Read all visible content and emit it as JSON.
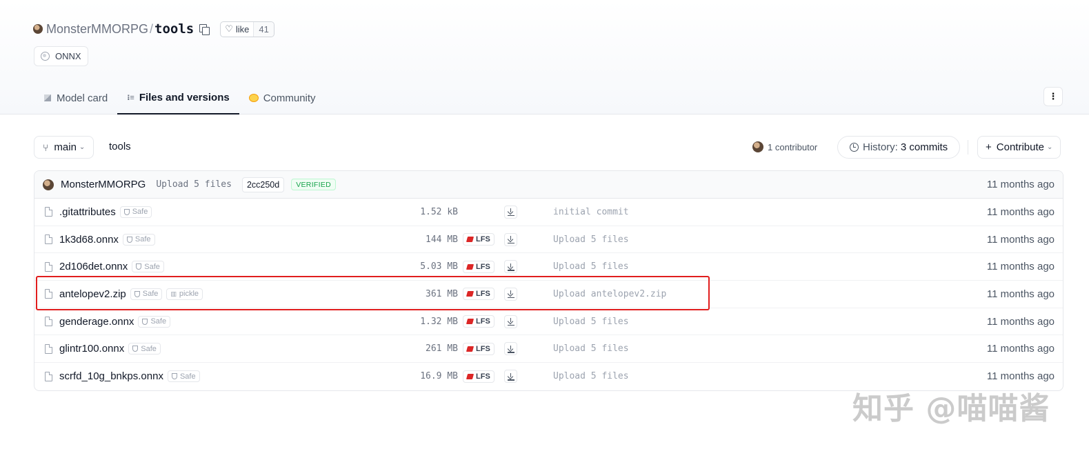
{
  "repo": {
    "owner": "MonsterMMORPG",
    "separator": "/",
    "name": "tools",
    "like_label": "like",
    "like_count": "41",
    "tag": "ONNX"
  },
  "tabs": [
    {
      "label": "Model card"
    },
    {
      "label": "Files and versions"
    },
    {
      "label": "Community"
    }
  ],
  "toolbar": {
    "branch": "main",
    "path": "tools",
    "contributors": "1 contributor",
    "history_label": "History:",
    "history_commits": "3 commits",
    "contribute_label": "Contribute"
  },
  "last_commit": {
    "author": "MonsterMMORPG",
    "message": "Upload 5 files",
    "hash": "2cc250d",
    "verified": "VERIFIED",
    "time": "11 months ago"
  },
  "files": [
    {
      "name": ".gitattributes",
      "safe": "Safe",
      "size": "1.52 kB",
      "lfs": "",
      "message": "initial commit",
      "time": "11 months ago"
    },
    {
      "name": "1k3d68.onnx",
      "safe": "Safe",
      "size": "144 MB",
      "lfs": "LFS",
      "message": "Upload 5 files",
      "time": "11 months ago"
    },
    {
      "name": "2d106det.onnx",
      "safe": "Safe",
      "size": "5.03 MB",
      "lfs": "LFS",
      "message": "Upload 5 files",
      "time": "11 months ago"
    },
    {
      "name": "antelopev2.zip",
      "safe": "Safe",
      "pickle": "pickle",
      "size": "361 MB",
      "lfs": "LFS",
      "message": "Upload antelopev2.zip",
      "time": "11 months ago"
    },
    {
      "name": "genderage.onnx",
      "safe": "Safe",
      "size": "1.32 MB",
      "lfs": "LFS",
      "message": "Upload 5 files",
      "time": "11 months ago"
    },
    {
      "name": "glintr100.onnx",
      "safe": "Safe",
      "size": "261 MB",
      "lfs": "LFS",
      "message": "Upload 5 files",
      "time": "11 months ago"
    },
    {
      "name": "scrfd_10g_bnkps.onnx",
      "safe": "Safe",
      "size": "16.9 MB",
      "lfs": "LFS",
      "message": "Upload 5 files",
      "time": "11 months ago"
    }
  ],
  "watermark": "知乎 @喵喵酱",
  "colors": {
    "highlight": "#e11d1d",
    "verified": "#16a34a",
    "lfs_icon": "#dc2626"
  }
}
